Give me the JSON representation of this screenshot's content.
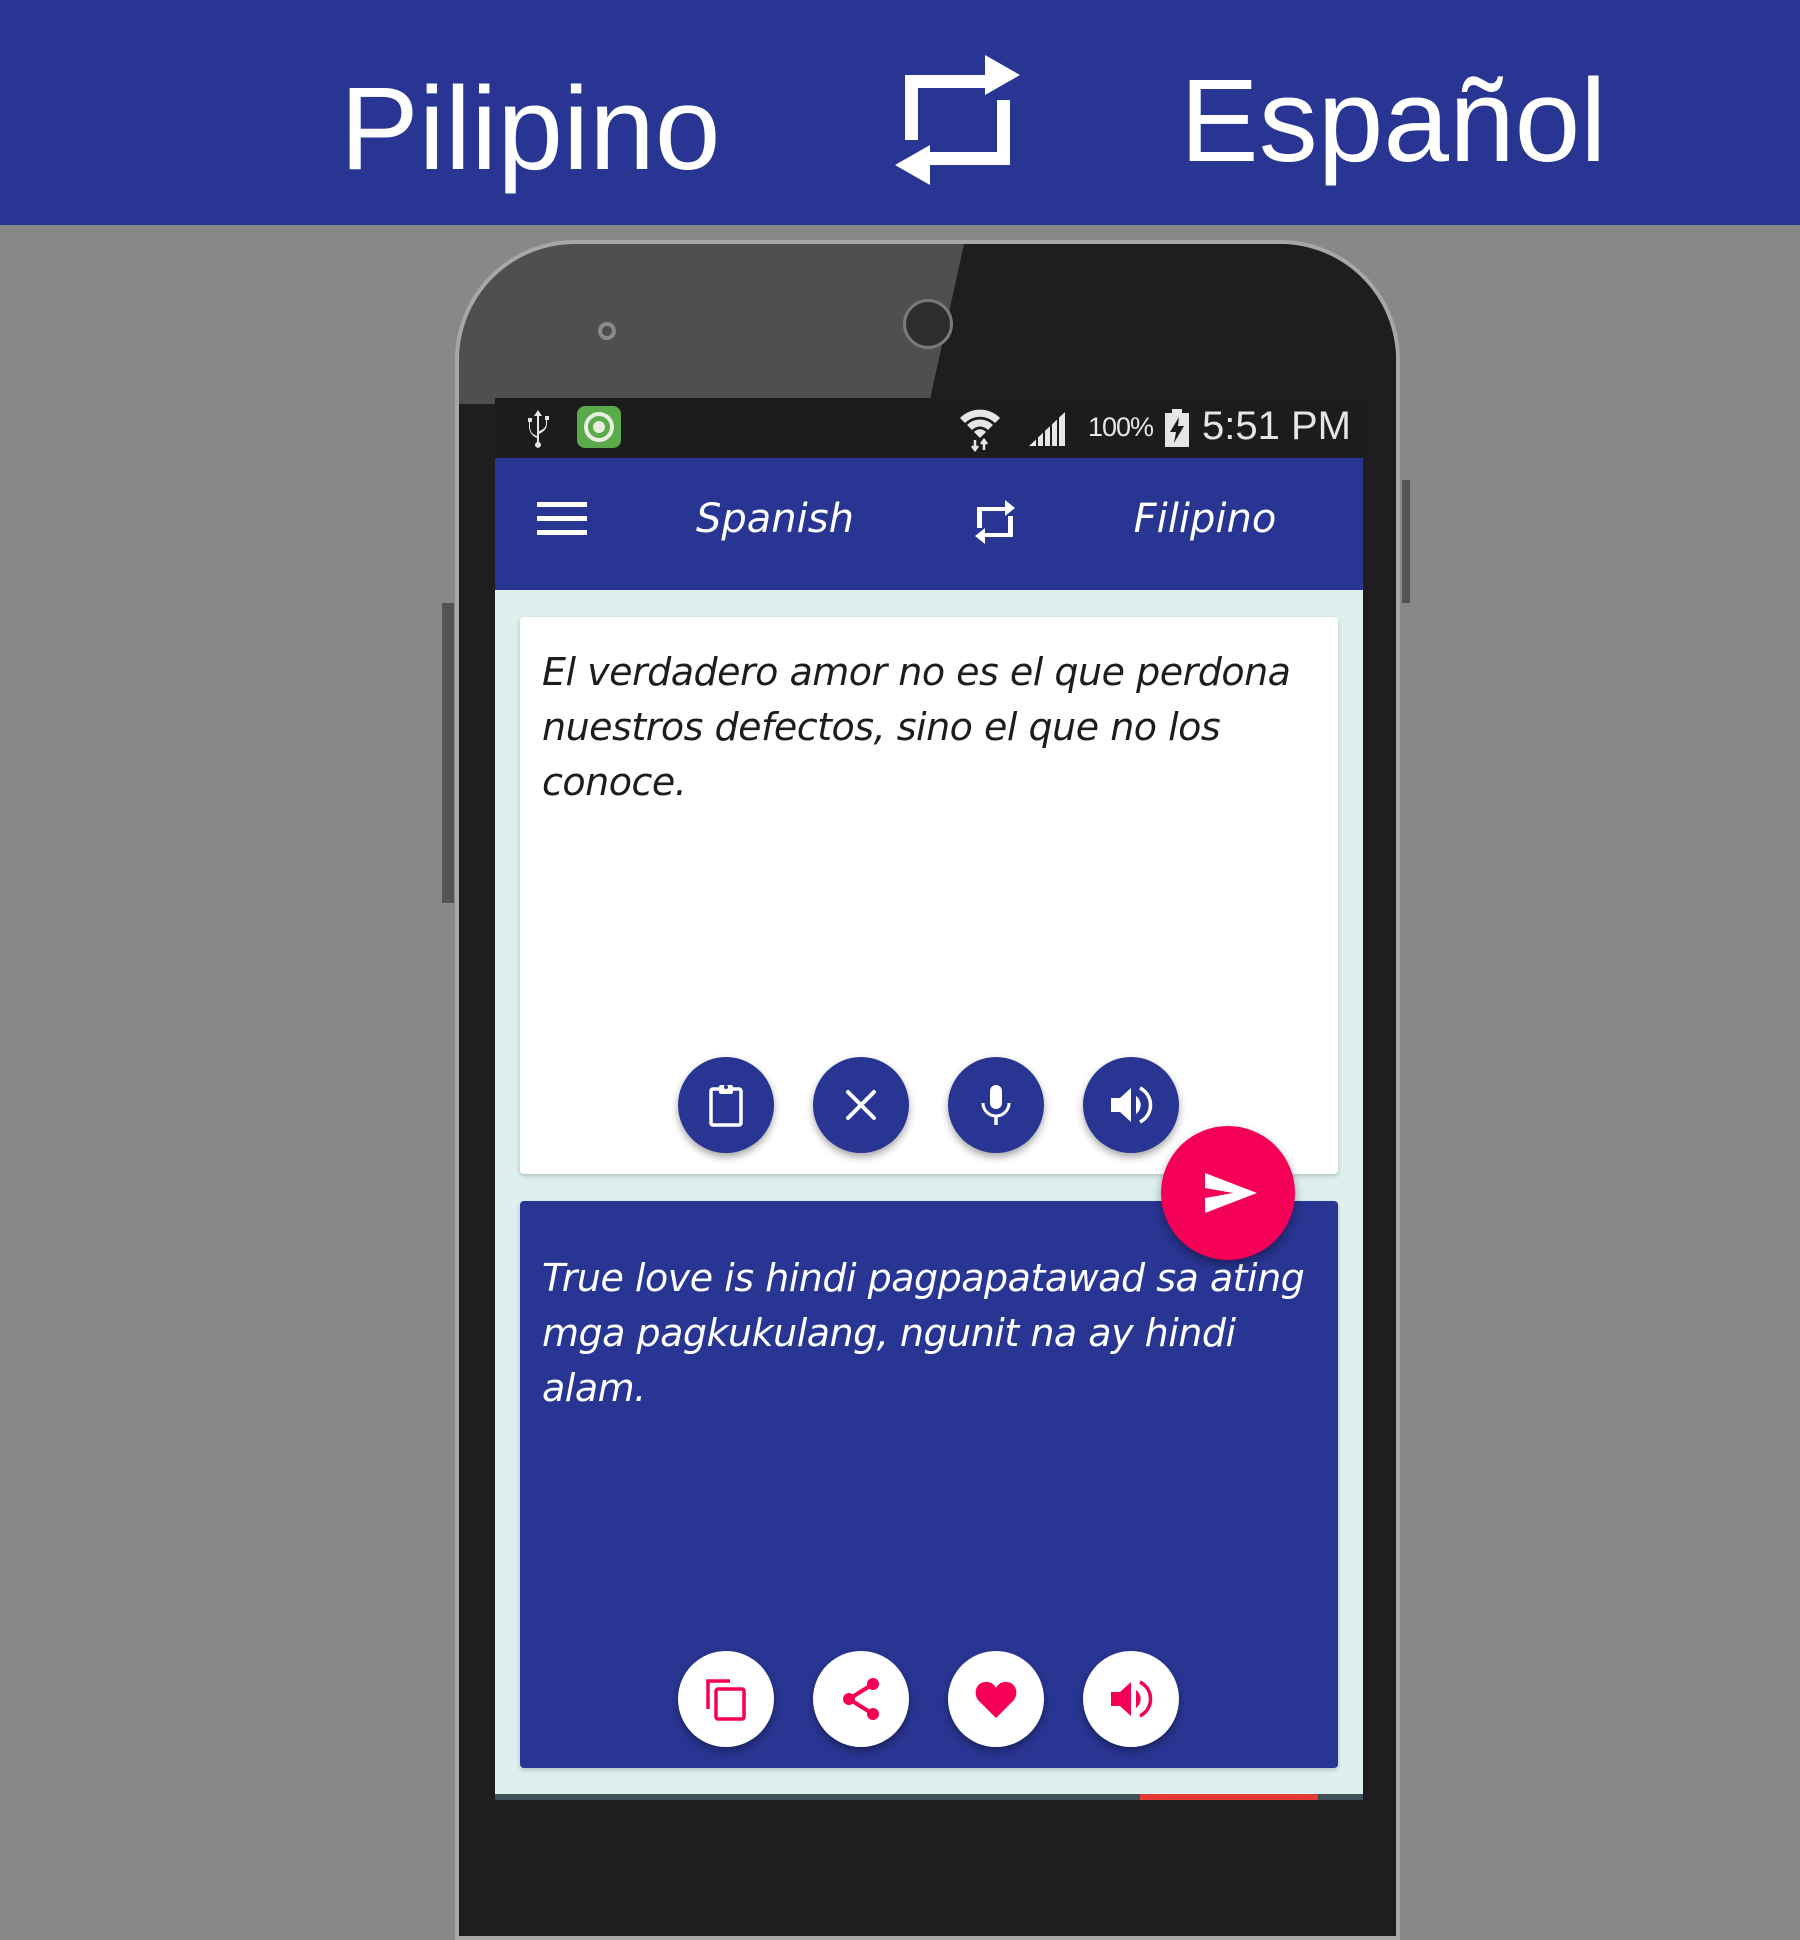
{
  "banner": {
    "left_language": "Pilipino",
    "right_language": "Español",
    "swap_icon": "swap-arrows-icon"
  },
  "colors": {
    "primary": "#293592",
    "accent": "#f50057",
    "content_background": "#ddf0ee",
    "page_background": "#888888"
  },
  "status_bar": {
    "icons": [
      "usb-icon",
      "app-notification-icon",
      "wifi-icon",
      "signal-icon",
      "battery-charging-icon"
    ],
    "battery_percent": "100%",
    "time": "5:51 PM"
  },
  "app_bar": {
    "menu_icon": "hamburger-menu-icon",
    "source_language": "Spanish",
    "swap_icon": "swap-arrows-icon",
    "target_language": "Filipino"
  },
  "input_card": {
    "text": "El verdadero amor no es el que perdona nuestros defectos, sino el que no los conoce.",
    "buttons": [
      {
        "name": "paste",
        "icon": "clipboard-icon"
      },
      {
        "name": "clear",
        "icon": "close-icon"
      },
      {
        "name": "voice-input",
        "icon": "microphone-icon"
      },
      {
        "name": "speak",
        "icon": "volume-icon"
      }
    ]
  },
  "translate_button": {
    "icon": "send-icon"
  },
  "output_card": {
    "text": "True love is hindi pagpapatawad sa ating mga pagkukulang, ngunit na ay hindi alam.",
    "buttons": [
      {
        "name": "copy",
        "icon": "copy-icon"
      },
      {
        "name": "share",
        "icon": "share-icon"
      },
      {
        "name": "favorite",
        "icon": "heart-icon"
      },
      {
        "name": "speak",
        "icon": "volume-icon"
      }
    ]
  }
}
